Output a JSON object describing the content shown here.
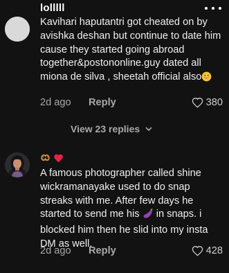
{
  "comments": [
    {
      "username": "lolllll",
      "text": "Kavihari haputantri got cheated on by avishka deshan but continue to date him cause they started going abroad together&postononline.guy dated all miona de silva , sheetah official also",
      "text_emoji": "grinning-sweat-emoji",
      "date": "2d ago",
      "reply_label": "Reply",
      "likes": "380",
      "view_replies_label": "View 23 replies"
    },
    {
      "emoji_prefix": [
        "pretzel-emoji",
        "red-heart-emoji"
      ],
      "text_part1": "A famous photographer called shine wickramanayake used to do snap streaks with me. After few days he started to send me his",
      "text_emoji": "eggplant-emoji",
      "text_part2": " in snaps. i blocked him then he slid into my insta DM as well.",
      "date": "2d ago",
      "reply_label": "Reply",
      "likes": "428"
    }
  ],
  "colors": {
    "background": "#121212",
    "primary_text": "#f0f0f0",
    "secondary_text": "#a9a9a9",
    "heart": "#e8214a"
  },
  "icons": {
    "more": "more-horizontal-icon",
    "like": "heart-outline-icon",
    "expand": "chevron-down-icon"
  }
}
